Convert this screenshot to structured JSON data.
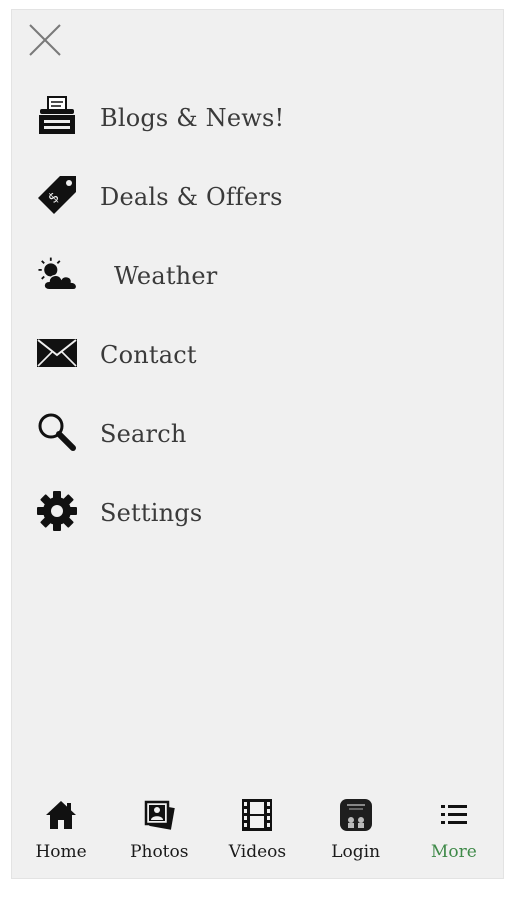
{
  "menu": {
    "close_icon": "close-x-icon",
    "items": [
      {
        "label": "Blogs & News!",
        "icon": "typewriter-icon"
      },
      {
        "label": "Deals & Offers",
        "icon": "price-tag-icon"
      },
      {
        "label": "Weather",
        "icon": "sun-cloud-icon"
      },
      {
        "label": "Contact",
        "icon": "envelope-icon"
      },
      {
        "label": "Search",
        "icon": "magnifier-icon"
      },
      {
        "label": "Settings",
        "icon": "gear-icon"
      }
    ]
  },
  "tabbar": {
    "items": [
      {
        "label": "Home",
        "icon": "home-icon",
        "active": false
      },
      {
        "label": "Photos",
        "icon": "photos-icon",
        "active": false
      },
      {
        "label": "Videos",
        "icon": "film-strip-icon",
        "active": false
      },
      {
        "label": "Login",
        "icon": "login-app-icon",
        "active": false
      },
      {
        "label": "More",
        "icon": "list-icon",
        "active": true
      }
    ]
  },
  "colors": {
    "panel_bg": "#f0f0f0",
    "text": "#3a3a3a",
    "active_tab": "#3f8a49"
  }
}
